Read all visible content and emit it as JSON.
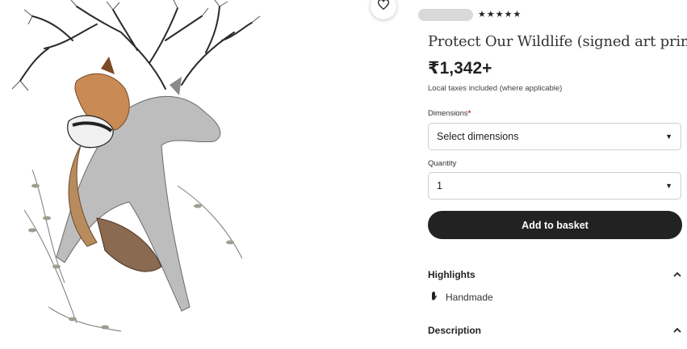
{
  "product": {
    "rating_stars": "★★★★★",
    "title": "Protect Our Wildlife (signed art print)",
    "price": "₹1,342+",
    "tax_note": "Local taxes included (where applicable)"
  },
  "form": {
    "dimensions_label": "Dimensions",
    "required_marker": "*",
    "dimensions_value": "Select dimensions",
    "quantity_label": "Quantity",
    "quantity_value": "1",
    "add_to_basket_label": "Add to basket"
  },
  "sections": {
    "highlights_label": "Highlights",
    "handmade_label": "Handmade",
    "description_label": "Description"
  },
  "icons": {
    "favorite": "heart-icon",
    "caret": "caret-down-icon",
    "chevron": "chevron-up-icon",
    "handmade": "hand-icon"
  },
  "colors": {
    "button_bg": "#222222",
    "required": "#c4301c"
  }
}
